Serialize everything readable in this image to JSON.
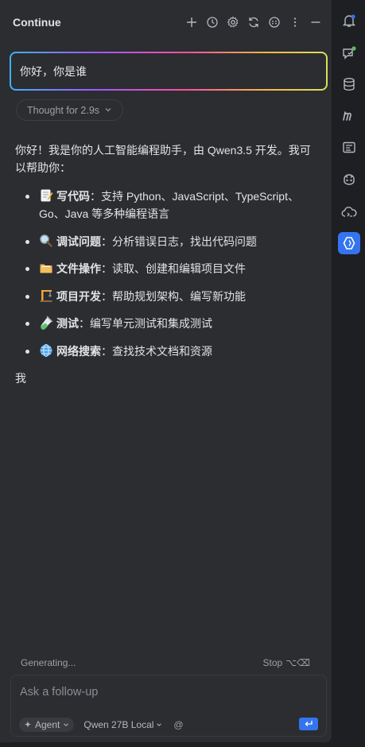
{
  "header": {
    "title": "Continue",
    "icons": [
      "plus-icon",
      "history-icon",
      "gear-icon",
      "refresh-icon",
      "emoji-icon",
      "more-icon",
      "minimize-icon"
    ]
  },
  "conversation": {
    "user_message": "你好，你是谁",
    "thought_label": "Thought for 2.9s",
    "intro": "你好！我是你的人工智能编程助手，由 Qwen3.5 开发。我可以帮助你：",
    "items": [
      {
        "emoji": "memo",
        "title": "写代码",
        "text": "：支持 Python、JavaScript、TypeScript、Go、Java 等多种编程语言"
      },
      {
        "emoji": "magnifier",
        "title": "调试问题",
        "text": "：分析错误日志，找出代码问题"
      },
      {
        "emoji": "folder",
        "title": "文件操作",
        "text": "：读取、创建和编辑项目文件"
      },
      {
        "emoji": "construction",
        "title": "项目开发",
        "text": "：帮助规划架构、编写新功能"
      },
      {
        "emoji": "test-tube",
        "title": "测试",
        "text": "：编写单元测试和集成测试"
      },
      {
        "emoji": "globe",
        "title": "网络搜索",
        "text": "：查找技术文档和资源"
      }
    ],
    "tail": "我"
  },
  "status": {
    "generating": "Generating...",
    "stop_label": "Stop",
    "stop_shortcut": "⌥⌫"
  },
  "input": {
    "placeholder": "Ask a follow-up",
    "mode": "Agent",
    "model": "Qwen 27B Local",
    "at_symbol": "@"
  },
  "sidebar": {
    "icons": [
      "notifications-icon",
      "ai-chat-icon",
      "database-icon",
      "m-icon",
      "terminal-log-icon",
      "copilot-icon",
      "cloud-code-icon",
      "continue-icon"
    ],
    "active": "continue-icon"
  },
  "colors": {
    "accent": "#3574f0",
    "panel_bg": "#2b2d30",
    "window_bg": "#1e1f22"
  }
}
